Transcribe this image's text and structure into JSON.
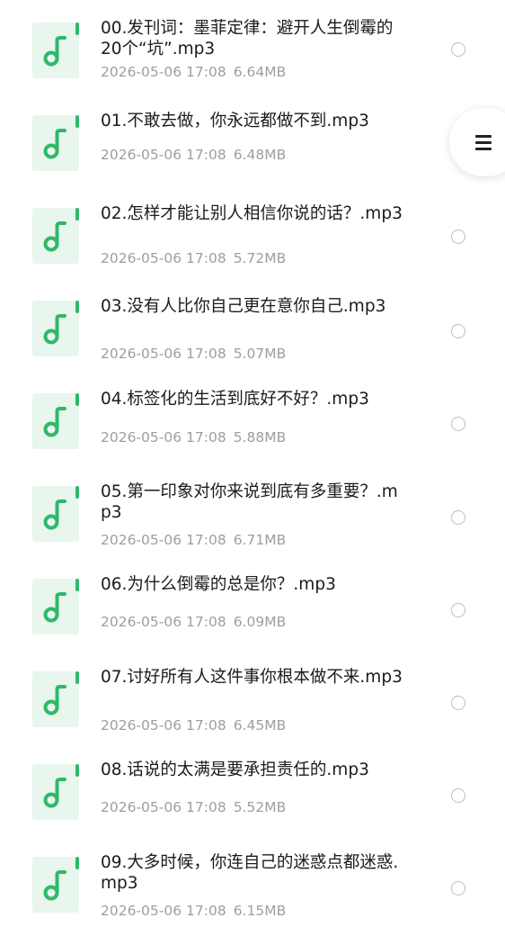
{
  "files": [
    {
      "name": "00.发刊词：墨菲定律：避开人生倒霉的20个“坑”.mp3",
      "date": "2026-05-06 17:08",
      "size": "6.64MB"
    },
    {
      "name": "01.不敢去做，你永远都做不到.mp3",
      "date": "2026-05-06 17:08",
      "size": "6.48MB"
    },
    {
      "name": "02.怎样才能让别人相信你说的话？.mp3",
      "date": "2026-05-06 17:08",
      "size": "5.72MB"
    },
    {
      "name": "03.没有人比你自己更在意你自己.mp3",
      "date": "2026-05-06 17:08",
      "size": "5.07MB"
    },
    {
      "name": "04.标签化的生活到底好不好？.mp3",
      "date": "2026-05-06 17:08",
      "size": "5.88MB"
    },
    {
      "name": "05.第一印象对你来说到底有多重要？.mp3",
      "date": "2026-05-06 17:08",
      "size": "6.71MB"
    },
    {
      "name": "06.为什么倒霉的总是你？.mp3",
      "date": "2026-05-06 17:08",
      "size": "6.09MB"
    },
    {
      "name": "07.讨好所有人这件事你根本做不来.mp3",
      "date": "2026-05-06 17:08",
      "size": "6.45MB"
    },
    {
      "name": "08.话说的太满是要承担责任的.mp3",
      "date": "2026-05-06 17:08",
      "size": "5.52MB"
    },
    {
      "name": "09.大多时候，你连自己的迷惑点都迷惑.mp3",
      "date": "2026-05-06 17:08",
      "size": "6.15MB"
    }
  ],
  "icons": {
    "file": "audio-file-icon",
    "select": "radio-circle",
    "menu": "hamburger-menu-icon"
  },
  "colors": {
    "audio_icon_green": "#2fb86a",
    "audio_icon_bg": "#eaf6ee",
    "title_text": "#1b1b1b",
    "meta_text": "#9e9e9e"
  }
}
